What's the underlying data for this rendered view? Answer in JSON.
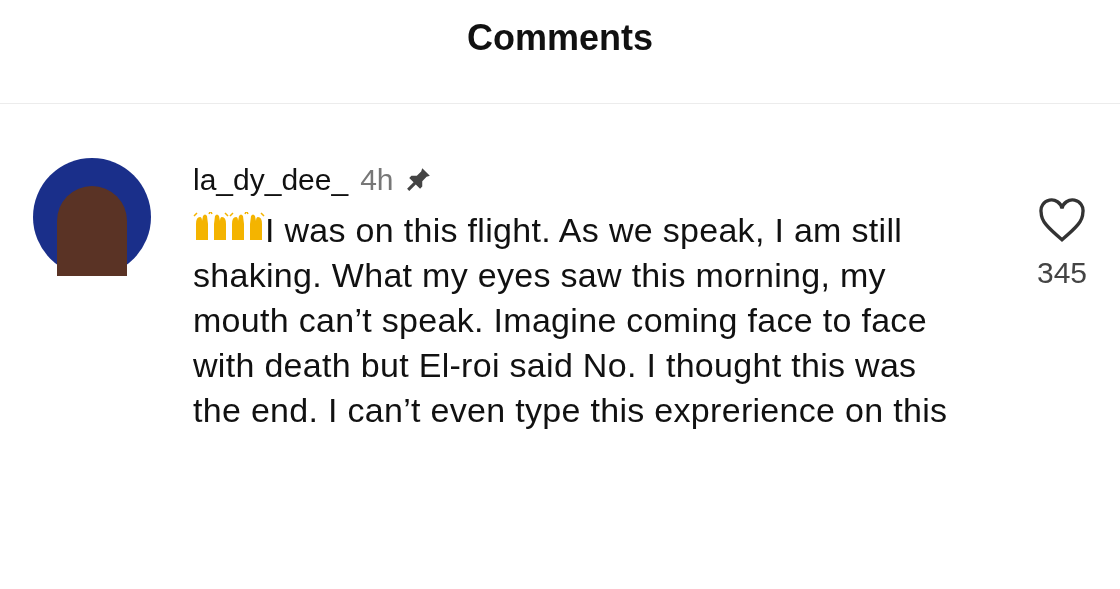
{
  "header": {
    "title": "Comments"
  },
  "comment": {
    "username": "la_dy_dee_",
    "time": "4h",
    "pinned": true,
    "text": "I was on this flight. As we speak, I am still shaking. What my eyes saw this morning, my mouth can’t speak. Imagine coming face to face with death but El-roi said No. I thought this was the end. I can’t even type this exprerience on this",
    "liked": false,
    "likes": "345"
  }
}
